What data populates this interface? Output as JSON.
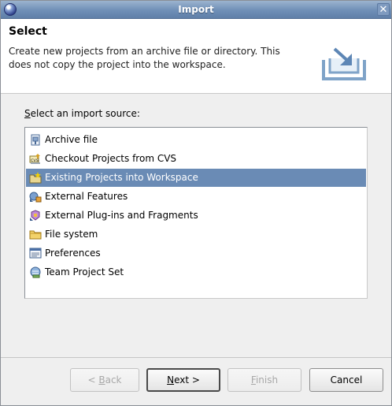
{
  "window": {
    "title": "Import"
  },
  "header": {
    "title": "Select",
    "description": "Create new projects from an archive file or directory. This does not copy the project into the workspace."
  },
  "source": {
    "label_mnemonic": "S",
    "label_rest": "elect an import source:"
  },
  "list": {
    "items": [
      {
        "label": "Archive file",
        "icon": "archive-file-icon"
      },
      {
        "label": "Checkout Projects from CVS",
        "icon": "cvs-icon"
      },
      {
        "label": "Existing Projects into Workspace",
        "icon": "project-folder-icon",
        "selected": true
      },
      {
        "label": "External Features",
        "icon": "features-icon"
      },
      {
        "label": "External Plug-ins and Fragments",
        "icon": "plugin-icon"
      },
      {
        "label": "File system",
        "icon": "folder-icon"
      },
      {
        "label": "Preferences",
        "icon": "preferences-icon"
      },
      {
        "label": "Team Project Set",
        "icon": "team-icon"
      }
    ]
  },
  "buttons": {
    "back_pre": "< ",
    "back_mnemonic": "B",
    "back_rest": "ack",
    "next_mnemonic": "N",
    "next_rest": "ext >",
    "finish_mnemonic": "F",
    "finish_rest": "inish",
    "cancel": "Cancel"
  },
  "colors": {
    "titlebar": "#6f8fb7",
    "selection": "#6a8bb5"
  }
}
